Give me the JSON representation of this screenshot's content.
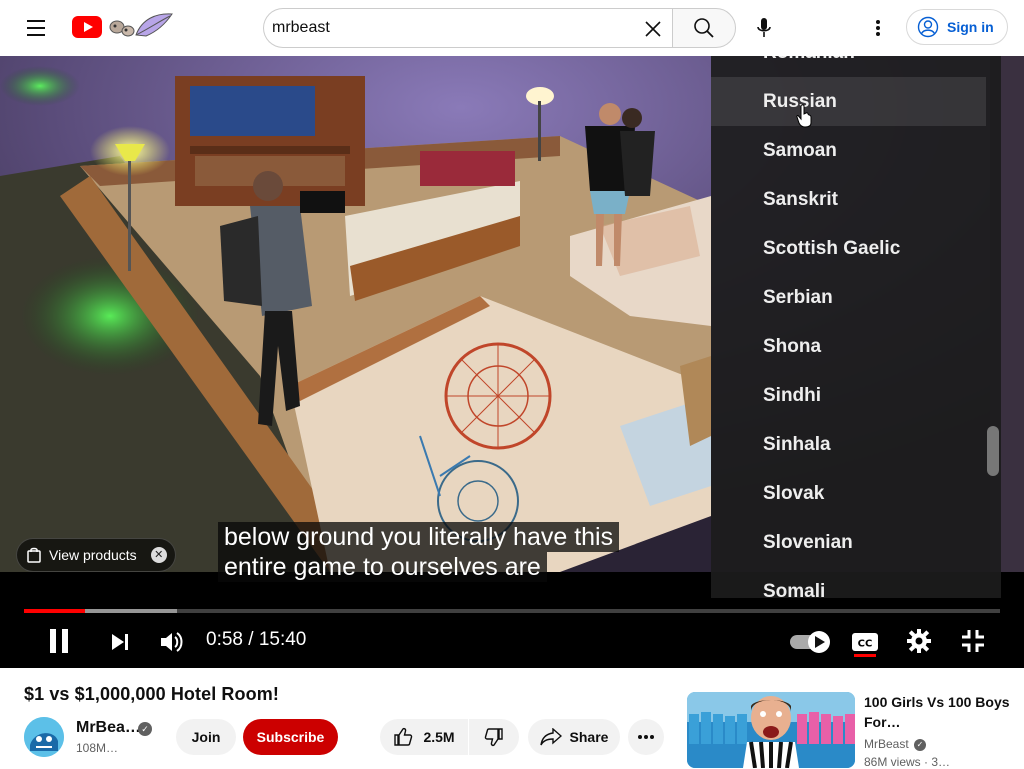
{
  "header": {
    "search_value": "mrbeast",
    "sign_in_label": "Sign in"
  },
  "player": {
    "subtitle_line1": "below ground you literally have this",
    "subtitle_line2": "entire game to ourselves are",
    "products_chip_label": "View products",
    "time_display": "0:58 / 15:40",
    "progress_fraction": 0.062,
    "buffered_fraction": 0.157,
    "language_menu": {
      "items": [
        "Romanian",
        "Russian",
        "Samoan",
        "Sanskrit",
        "Scottish Gaelic",
        "Serbian",
        "Shona",
        "Sindhi",
        "Sinhala",
        "Slovak",
        "Slovenian",
        "Somali"
      ],
      "hovered": "Russian"
    }
  },
  "video": {
    "title": "$1 vs $1,000,000 Hotel Room!",
    "channel_name": "MrBea…",
    "subscriber_count": "108M…",
    "join_label": "Join",
    "subscribe_label": "Subscribe",
    "like_count": "2.5M",
    "share_label": "Share"
  },
  "recommendation": {
    "title": "100 Girls Vs 100 Boys For…",
    "channel": "MrBeast",
    "meta": "86M views · 3…"
  },
  "colors": {
    "brand_red": "#ff0000",
    "subscribe_red": "#cc0000",
    "link_blue": "#065fd4",
    "progress_red": "#ff0000"
  }
}
